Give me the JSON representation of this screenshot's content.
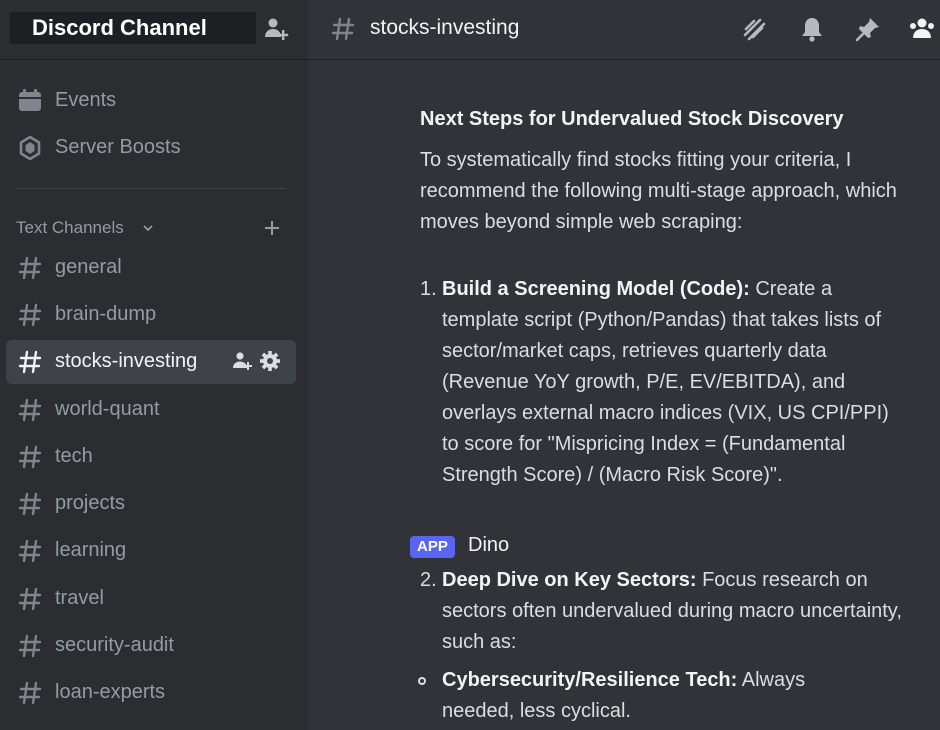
{
  "server": {
    "title": "Discord Channel"
  },
  "sidebar": {
    "nav": [
      {
        "label": "Events",
        "icon": "calendar-icon"
      },
      {
        "label": "Server Boosts",
        "icon": "boost-gem-icon"
      }
    ],
    "category": {
      "label": "Text Channels",
      "chevron_icon": "chevron-down-icon",
      "add_icon": "plus-icon"
    },
    "channels": [
      {
        "label": "general"
      },
      {
        "label": "brain-dump"
      },
      {
        "label": "stocks-investing",
        "active": true
      },
      {
        "label": "world-quant"
      },
      {
        "label": "tech"
      },
      {
        "label": "projects"
      },
      {
        "label": "learning"
      },
      {
        "label": "travel"
      },
      {
        "label": "security-audit"
      },
      {
        "label": "loan-experts"
      }
    ]
  },
  "topbar": {
    "channel_name": "stocks-investing",
    "icons": [
      "threads-icon",
      "bell-icon",
      "pin-icon",
      "members-icon"
    ]
  },
  "message": {
    "heading": "Next Steps for Undervalued Stock Discovery",
    "intro": "To systematically find stocks fitting your criteria, I recommend the following multi-stage approach, which moves beyond simple web scraping:",
    "step1": {
      "num": "1.",
      "title": "Build a Screening Model (Code):",
      "text": " Create a template script (Python/Pandas) that takes lists of sector/market caps, retrieves quarterly data (Revenue YoY growth, P/E, EV/EBITDA), and overlays external macro indices (VIX, US CPI/PPI) to score for \"Mispricing Index = (Fundamental Strength Score) / (Macro Risk Score)\"."
    },
    "app_badge": "APP",
    "author": "Dino",
    "step2": {
      "num": "2.",
      "title": "Deep Dive on Key Sectors:",
      "text": " Focus research on sectors often undervalued during macro uncertainty, such as:"
    },
    "sub1": {
      "title": "Cybersecurity/Resilience Tech:",
      "text": " Always needed, less cyclical."
    }
  },
  "colors": {
    "accent": "#5865f2",
    "sidebar": "#2b2d31",
    "chat": "#313338",
    "active_row": "#404249"
  }
}
